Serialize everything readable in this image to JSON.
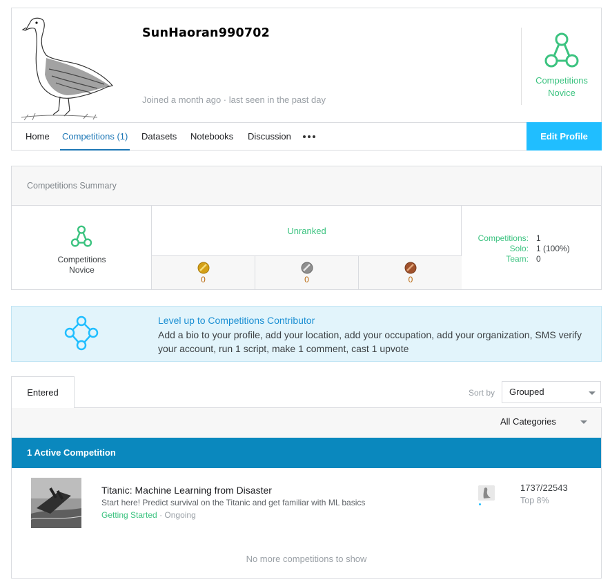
{
  "profile": {
    "username": "SunHaoran990702",
    "joined": "Joined a month ago · last seen in the past day",
    "tier": "Competitions Novice",
    "avatar": "goose-illustration"
  },
  "nav": {
    "items": [
      {
        "label": "Home",
        "active": false
      },
      {
        "label": "Competitions (1)",
        "active": true
      },
      {
        "label": "Datasets",
        "active": false
      },
      {
        "label": "Notebooks",
        "active": false
      },
      {
        "label": "Discussion",
        "active": false
      }
    ],
    "more_icon": "ellipsis-icon",
    "edit_profile": "Edit Profile"
  },
  "summary": {
    "title": "Competitions Summary",
    "tier_line1": "Competitions",
    "tier_line2": "Novice",
    "rank": "Unranked",
    "medals": [
      {
        "type": "gold",
        "count": "0"
      },
      {
        "type": "silver",
        "count": "0"
      },
      {
        "type": "bronze",
        "count": "0"
      }
    ],
    "stats": [
      {
        "key": "Competitions:",
        "value": "1"
      },
      {
        "key": "Solo:",
        "value": "1 (100%)"
      },
      {
        "key": "Team:",
        "value": "0"
      }
    ]
  },
  "levelup": {
    "title": "Level up to Competitions Contributor",
    "text": "Add a bio to your profile, add your location, add your occupation, add your organization, SMS verify your account, run 1 script, make 1 comment, cast 1 upvote"
  },
  "competitions": {
    "tab": "Entered",
    "sort_label": "Sort by",
    "sort_value": "Grouped",
    "category_value": "All Categories",
    "active_header": "1 Active Competition",
    "items": [
      {
        "title": "Titanic: Machine Learning from Disaster",
        "description": "Start here! Predict survival on the Titanic and get familiar with ML basics",
        "category": "Getting Started",
        "separator": "·",
        "status": "Ongoing",
        "rank": "1737/22543",
        "top": "Top 8%"
      }
    ],
    "footer": "No more competitions to show"
  },
  "colors": {
    "accent": "#20beff",
    "novice_green": "#3cc380",
    "active_bar": "#0a88be",
    "tab_active": "#1b76b5",
    "levelup_bg": "#e2f4fb"
  }
}
